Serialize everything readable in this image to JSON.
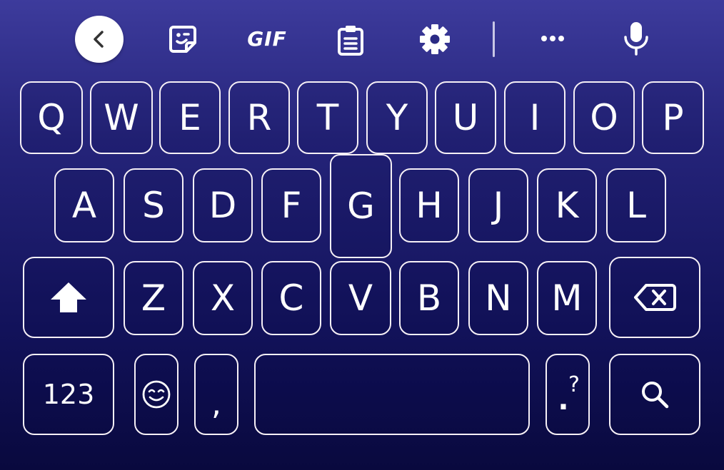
{
  "toolbar": {
    "back": "back",
    "sticker": "sticker",
    "gif_label": "GIF",
    "clipboard": "clipboard",
    "settings": "settings",
    "more": "more",
    "voice": "voice"
  },
  "keys": {
    "row1": [
      "Q",
      "W",
      "E",
      "R",
      "T",
      "Y",
      "U",
      "I",
      "O",
      "P"
    ],
    "row2": [
      "A",
      "S",
      "D",
      "F",
      "G",
      "H",
      "J",
      "K",
      "L"
    ],
    "row3": [
      "Z",
      "X",
      "C",
      "V",
      "B",
      "N",
      "M"
    ],
    "row4": {
      "numbers_label": "123",
      "comma": ",",
      "period_top": "?",
      "period_bottom": "."
    }
  },
  "pressed_key": "G",
  "colors": {
    "background_top": "#3d3b9c",
    "background_bottom": "#09093e",
    "key_border": "#f6f0f6",
    "text": "#ffffff"
  }
}
